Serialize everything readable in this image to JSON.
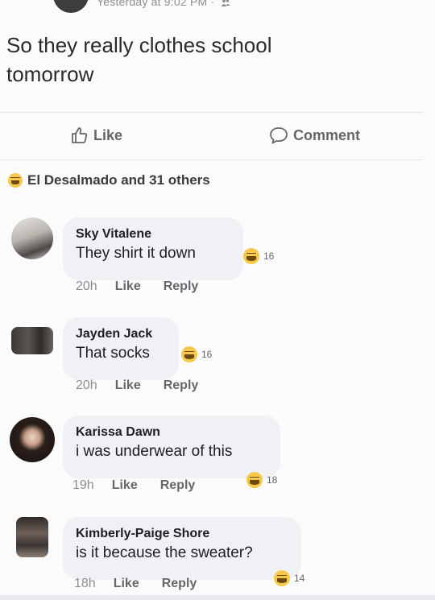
{
  "post": {
    "meta": "Yesterday at 9:02 PM",
    "text_lines": [
      "So they really clothes school",
      "tomorrow"
    ]
  },
  "actions": {
    "like_label": "Like",
    "comment_label": "Comment"
  },
  "reactions": {
    "summary": "El Desalmado and 31 others"
  },
  "comments": [
    {
      "name": "Sky Vitalene",
      "text": "They shirt it down",
      "reaction_count": "16",
      "time": "20h",
      "like_label": "Like",
      "reply_label": "Reply"
    },
    {
      "name": "Jayden Jack",
      "text": "That socks",
      "reaction_count": "16",
      "time": "20h",
      "like_label": "Like",
      "reply_label": "Reply"
    },
    {
      "name": "Karissa Dawn",
      "text": "i was underwear of this",
      "reaction_count": "18",
      "time": "19h",
      "like_label": "Like",
      "reply_label": "Reply"
    },
    {
      "name": "Kimberly-Paige Shore",
      "text": "is it because the sweater?",
      "reaction_count": "14",
      "time": "18h",
      "like_label": "Like",
      "reply_label": "Reply"
    }
  ],
  "colors": {
    "bubble": "#eff1f4",
    "secondary_text": "#65676b",
    "laugh_emoji": "#f7c94a"
  },
  "icons": {
    "like": "thumbs-up-icon",
    "comment": "speech-bubble-icon",
    "reaction": "laughing-face-icon",
    "audience": "friends-icon"
  }
}
